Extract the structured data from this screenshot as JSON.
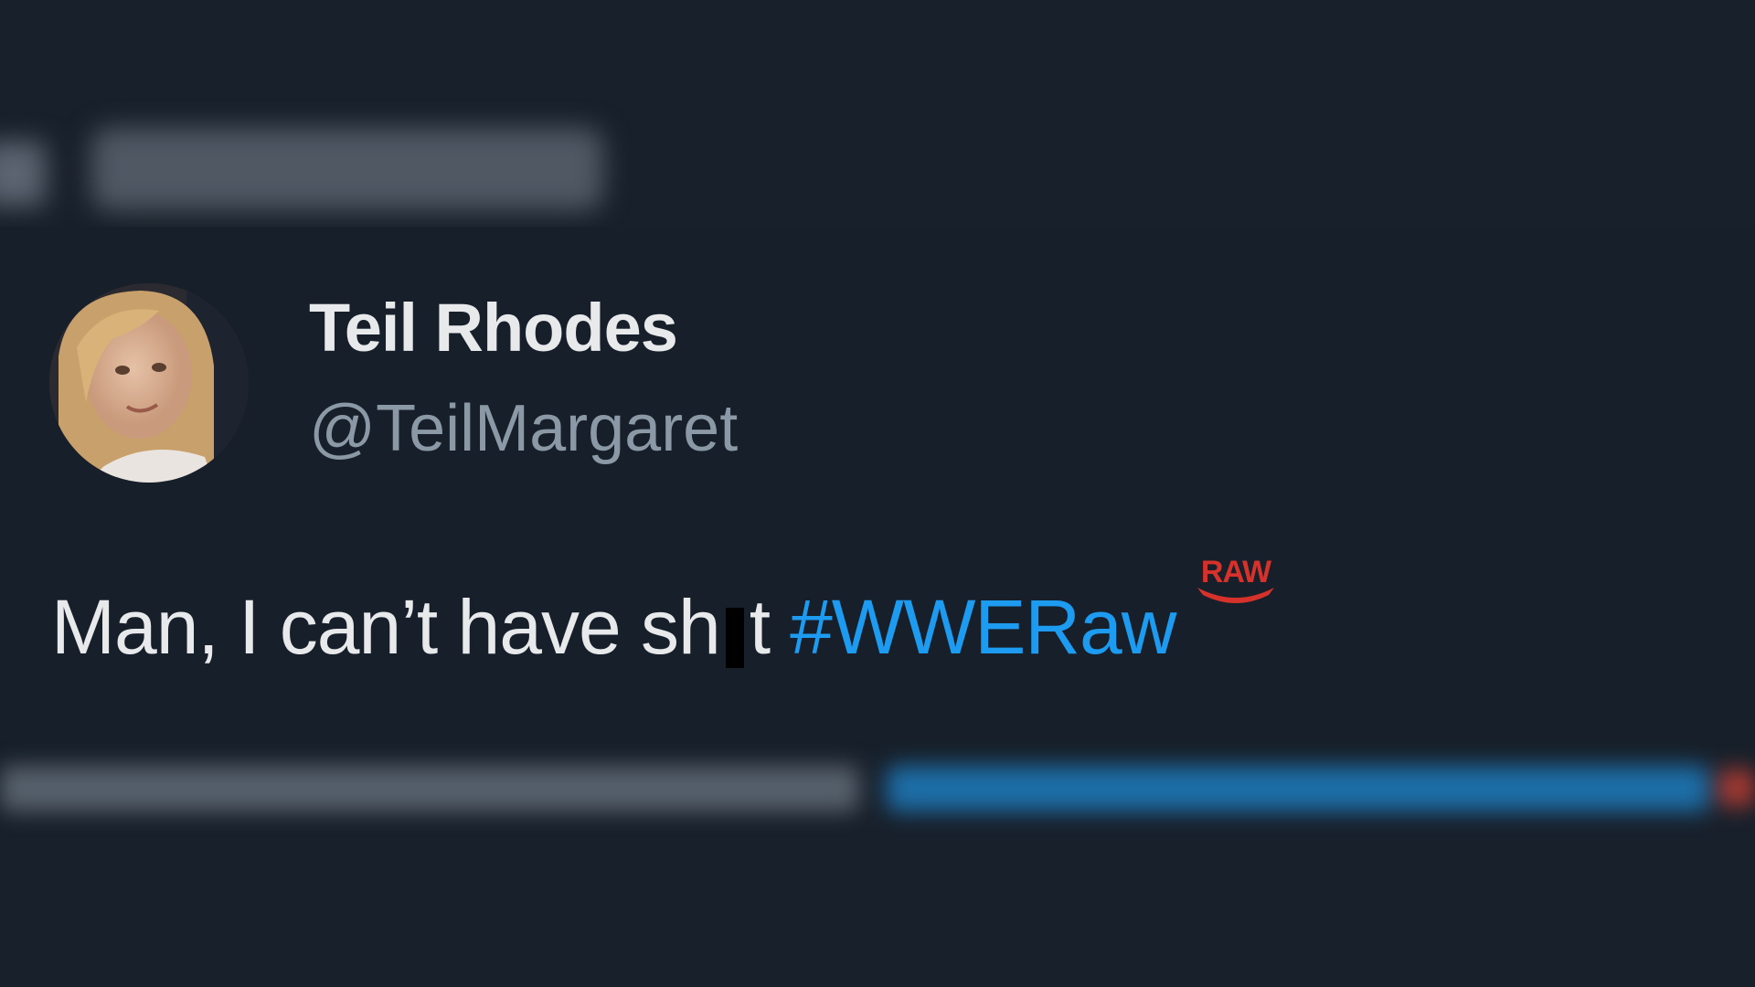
{
  "tweet": {
    "display_name": "Teil Rhodes",
    "handle": "@TeilMargaret",
    "text_before_censor": "Man, I can’t have sh",
    "text_after_censor": "t",
    "hashtag": "#WWERaw",
    "hashtag_emoji_label": "RAW"
  },
  "colors": {
    "background": "#18202b",
    "name": "#e7e9ea",
    "handle": "#8b98a5",
    "hashtag": "#1d9bf0",
    "raw_logo": "#d6322b"
  }
}
